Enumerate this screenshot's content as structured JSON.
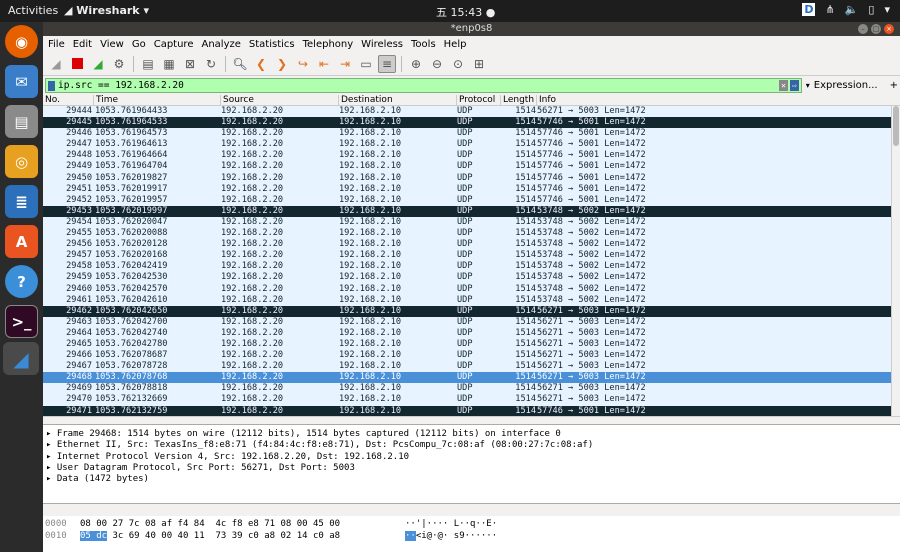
{
  "topbar": {
    "activities": "Activities",
    "app_name": "Wireshark",
    "clock": "五 15:43 ●"
  },
  "window": {
    "title": "*enp0s8"
  },
  "menu": [
    "File",
    "Edit",
    "View",
    "Go",
    "Capture",
    "Analyze",
    "Statistics",
    "Telephony",
    "Wireless",
    "Tools",
    "Help"
  ],
  "filter": {
    "value": "ip.src == 192.168.2.20",
    "expression_label": "Expression...",
    "plus": "+"
  },
  "columns": [
    "No.",
    "Time",
    "Source",
    "Destination",
    "Protocol",
    "Length",
    "Info"
  ],
  "packets": [
    {
      "no": "29444",
      "time": "1053.761964433",
      "src": "192.168.2.20",
      "dst": "192.168.2.10",
      "proto": "UDP",
      "len": "1514",
      "info": "56271 → 5003 Len=1472",
      "style": ""
    },
    {
      "no": "29445",
      "time": "1053.761964533",
      "src": "192.168.2.20",
      "dst": "192.168.2.10",
      "proto": "UDP",
      "len": "1514",
      "info": "57746 → 5001 Len=1472",
      "style": "black"
    },
    {
      "no": "29446",
      "time": "1053.761964573",
      "src": "192.168.2.20",
      "dst": "192.168.2.10",
      "proto": "UDP",
      "len": "1514",
      "info": "57746 → 5001 Len=1472",
      "style": ""
    },
    {
      "no": "29447",
      "time": "1053.761964613",
      "src": "192.168.2.20",
      "dst": "192.168.2.10",
      "proto": "UDP",
      "len": "1514",
      "info": "57746 → 5001 Len=1472",
      "style": ""
    },
    {
      "no": "29448",
      "time": "1053.761964664",
      "src": "192.168.2.20",
      "dst": "192.168.2.10",
      "proto": "UDP",
      "len": "1514",
      "info": "57746 → 5001 Len=1472",
      "style": ""
    },
    {
      "no": "29449",
      "time": "1053.761964704",
      "src": "192.168.2.20",
      "dst": "192.168.2.10",
      "proto": "UDP",
      "len": "1514",
      "info": "57746 → 5001 Len=1472",
      "style": ""
    },
    {
      "no": "29450",
      "time": "1053.762019827",
      "src": "192.168.2.20",
      "dst": "192.168.2.10",
      "proto": "UDP",
      "len": "1514",
      "info": "57746 → 5001 Len=1472",
      "style": ""
    },
    {
      "no": "29451",
      "time": "1053.762019917",
      "src": "192.168.2.20",
      "dst": "192.168.2.10",
      "proto": "UDP",
      "len": "1514",
      "info": "57746 → 5001 Len=1472",
      "style": ""
    },
    {
      "no": "29452",
      "time": "1053.762019957",
      "src": "192.168.2.20",
      "dst": "192.168.2.10",
      "proto": "UDP",
      "len": "1514",
      "info": "57746 → 5001 Len=1472",
      "style": ""
    },
    {
      "no": "29453",
      "time": "1053.762019997",
      "src": "192.168.2.20",
      "dst": "192.168.2.10",
      "proto": "UDP",
      "len": "1514",
      "info": "53748 → 5002 Len=1472",
      "style": "black"
    },
    {
      "no": "29454",
      "time": "1053.762020047",
      "src": "192.168.2.20",
      "dst": "192.168.2.10",
      "proto": "UDP",
      "len": "1514",
      "info": "53748 → 5002 Len=1472",
      "style": ""
    },
    {
      "no": "29455",
      "time": "1053.762020088",
      "src": "192.168.2.20",
      "dst": "192.168.2.10",
      "proto": "UDP",
      "len": "1514",
      "info": "53748 → 5002 Len=1472",
      "style": ""
    },
    {
      "no": "29456",
      "time": "1053.762020128",
      "src": "192.168.2.20",
      "dst": "192.168.2.10",
      "proto": "UDP",
      "len": "1514",
      "info": "53748 → 5002 Len=1472",
      "style": ""
    },
    {
      "no": "29457",
      "time": "1053.762020168",
      "src": "192.168.2.20",
      "dst": "192.168.2.10",
      "proto": "UDP",
      "len": "1514",
      "info": "53748 → 5002 Len=1472",
      "style": ""
    },
    {
      "no": "29458",
      "time": "1053.762042419",
      "src": "192.168.2.20",
      "dst": "192.168.2.10",
      "proto": "UDP",
      "len": "1514",
      "info": "53748 → 5002 Len=1472",
      "style": ""
    },
    {
      "no": "29459",
      "time": "1053.762042530",
      "src": "192.168.2.20",
      "dst": "192.168.2.10",
      "proto": "UDP",
      "len": "1514",
      "info": "53748 → 5002 Len=1472",
      "style": ""
    },
    {
      "no": "29460",
      "time": "1053.762042570",
      "src": "192.168.2.20",
      "dst": "192.168.2.10",
      "proto": "UDP",
      "len": "1514",
      "info": "53748 → 5002 Len=1472",
      "style": ""
    },
    {
      "no": "29461",
      "time": "1053.762042610",
      "src": "192.168.2.20",
      "dst": "192.168.2.10",
      "proto": "UDP",
      "len": "1514",
      "info": "53748 → 5002 Len=1472",
      "style": ""
    },
    {
      "no": "29462",
      "time": "1053.762042650",
      "src": "192.168.2.20",
      "dst": "192.168.2.10",
      "proto": "UDP",
      "len": "1514",
      "info": "56271 → 5003 Len=1472",
      "style": "black"
    },
    {
      "no": "29463",
      "time": "1053.762042700",
      "src": "192.168.2.20",
      "dst": "192.168.2.10",
      "proto": "UDP",
      "len": "1514",
      "info": "56271 → 5003 Len=1472",
      "style": ""
    },
    {
      "no": "29464",
      "time": "1053.762042740",
      "src": "192.168.2.20",
      "dst": "192.168.2.10",
      "proto": "UDP",
      "len": "1514",
      "info": "56271 → 5003 Len=1472",
      "style": ""
    },
    {
      "no": "29465",
      "time": "1053.762042780",
      "src": "192.168.2.20",
      "dst": "192.168.2.10",
      "proto": "UDP",
      "len": "1514",
      "info": "56271 → 5003 Len=1472",
      "style": ""
    },
    {
      "no": "29466",
      "time": "1053.762078687",
      "src": "192.168.2.20",
      "dst": "192.168.2.10",
      "proto": "UDP",
      "len": "1514",
      "info": "56271 → 5003 Len=1472",
      "style": ""
    },
    {
      "no": "29467",
      "time": "1053.762078728",
      "src": "192.168.2.20",
      "dst": "192.168.2.10",
      "proto": "UDP",
      "len": "1514",
      "info": "56271 → 5003 Len=1472",
      "style": ""
    },
    {
      "no": "29468",
      "time": "1053.762078768",
      "src": "192.168.2.20",
      "dst": "192.168.2.10",
      "proto": "UDP",
      "len": "1514",
      "info": "56271 → 5003 Len=1472",
      "style": "sel"
    },
    {
      "no": "29469",
      "time": "1053.762078818",
      "src": "192.168.2.20",
      "dst": "192.168.2.10",
      "proto": "UDP",
      "len": "1514",
      "info": "56271 → 5003 Len=1472",
      "style": ""
    },
    {
      "no": "29470",
      "time": "1053.762132669",
      "src": "192.168.2.20",
      "dst": "192.168.2.10",
      "proto": "UDP",
      "len": "1514",
      "info": "56271 → 5003 Len=1472",
      "style": ""
    },
    {
      "no": "29471",
      "time": "1053.762132759",
      "src": "192.168.2.20",
      "dst": "192.168.2.10",
      "proto": "UDP",
      "len": "1514",
      "info": "57746 → 5001 Len=1472",
      "style": "black"
    }
  ],
  "details": [
    "Frame 29468: 1514 bytes on wire (12112 bits), 1514 bytes captured (12112 bits) on interface 0",
    "Ethernet II, Src: TexasIns_f8:e8:71 (f4:84:4c:f8:e8:71), Dst: PcsCompu_7c:08:af (08:00:27:7c:08:af)",
    "Internet Protocol Version 4, Src: 192.168.2.20, Dst: 192.168.2.10",
    "User Datagram Protocol, Src Port: 56271, Dst Port: 5003",
    "Data (1472 bytes)"
  ],
  "bytes": [
    {
      "offset": "0000",
      "hex_hl": "",
      "hex": "08 00 27 7c 08 af f4 84  4c f8 e8 71 08 00 45 00",
      "ascii_hl": "",
      "ascii": "··'|···· L··q··E·"
    },
    {
      "offset": "0010",
      "hex_hl": "05 dc",
      "hex": " 3c 69 40 00 40 11  73 39 c0 a8 02 14 c0 a8",
      "ascii_hl": "··",
      "ascii": "<i@·@· s9······"
    }
  ]
}
